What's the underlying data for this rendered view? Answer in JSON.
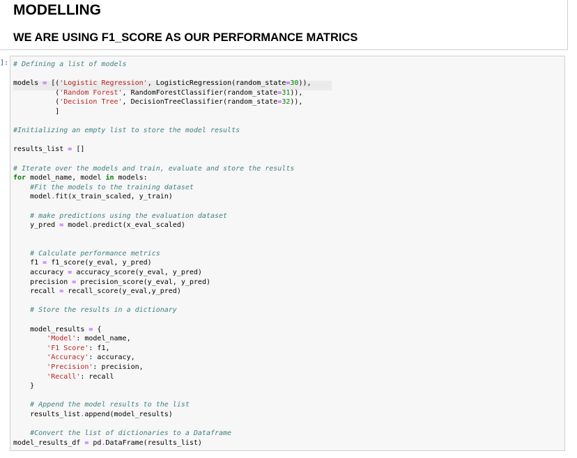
{
  "markdown": {
    "title": "MODELLING",
    "subtitle": "WE ARE USING F1_SCORE AS OUR PERFORMANCE MATRICS"
  },
  "code_cell": {
    "prompt": "]:",
    "lines": [
      [
        [
          "c",
          "# Defining a list of models"
        ]
      ],
      [],
      [
        [
          "",
          "models "
        ],
        [
          "o",
          "="
        ],
        [
          "",
          " [("
        ],
        [
          "s",
          "'Logistic Regression'"
        ],
        [
          "",
          ", LogisticRegression(random_state"
        ],
        [
          "o",
          "="
        ],
        [
          "n",
          "30"
        ],
        [
          "",
          ")),"
        ]
      ],
      [
        [
          "",
          "          ("
        ],
        [
          "s",
          "'Random Forest'"
        ],
        [
          "",
          ", RandomForestClassifier(random_state"
        ],
        [
          "o",
          "="
        ],
        [
          "n",
          "31"
        ],
        [
          "",
          ")),"
        ]
      ],
      [
        [
          "",
          "          ("
        ],
        [
          "s",
          "'Decision Tree'"
        ],
        [
          "",
          ", DecisionTreeClassifier(random_state"
        ],
        [
          "o",
          "="
        ],
        [
          "n",
          "32"
        ],
        [
          "",
          ")),"
        ]
      ],
      [
        [
          "",
          "          ]"
        ]
      ],
      [],
      [
        [
          "c",
          "#Initializing an empty list to store the model results"
        ]
      ],
      [],
      [
        [
          "",
          "results_list "
        ],
        [
          "o",
          "="
        ],
        [
          "",
          " []"
        ]
      ],
      [],
      [
        [
          "c",
          "# Iterate over the models and train, evaluate and store the results"
        ]
      ],
      [
        [
          "k",
          "for"
        ],
        [
          "",
          " model_name, model "
        ],
        [
          "k",
          "in"
        ],
        [
          "",
          " models:"
        ]
      ],
      [
        [
          "",
          "    "
        ],
        [
          "c",
          "#Fit the models to the training dataset"
        ]
      ],
      [
        [
          "",
          "    model"
        ],
        [
          "o",
          "."
        ],
        [
          "",
          "fit(x_train_scaled, y_train)"
        ]
      ],
      [],
      [
        [
          "",
          "    "
        ],
        [
          "c",
          "# make predictions using the evaluation dataset"
        ]
      ],
      [
        [
          "",
          "    y_pred "
        ],
        [
          "o",
          "="
        ],
        [
          "",
          " model"
        ],
        [
          "o",
          "."
        ],
        [
          "",
          "predict(x_eval_scaled)"
        ]
      ],
      [],
      [],
      [
        [
          "",
          "    "
        ],
        [
          "c",
          "# Calculate performance metrics"
        ]
      ],
      [
        [
          "",
          "    f1 "
        ],
        [
          "o",
          "="
        ],
        [
          "",
          " f1_score(y_eval, y_pred)"
        ]
      ],
      [
        [
          "",
          "    accuracy "
        ],
        [
          "o",
          "="
        ],
        [
          "",
          " accuracy_score(y_eval, y_pred)"
        ]
      ],
      [
        [
          "",
          "    precision "
        ],
        [
          "o",
          "="
        ],
        [
          "",
          " precision_score(y_eval, y_pred)"
        ]
      ],
      [
        [
          "",
          "    recall "
        ],
        [
          "o",
          "="
        ],
        [
          "",
          " recall_score(y_eval,y_pred)"
        ]
      ],
      [],
      [
        [
          "",
          "    "
        ],
        [
          "c",
          "# Store the results in a dictionary"
        ]
      ],
      [],
      [
        [
          "",
          "    model_results "
        ],
        [
          "o",
          "="
        ],
        [
          "",
          " {"
        ]
      ],
      [
        [
          "",
          "        "
        ],
        [
          "s",
          "'Model'"
        ],
        [
          "",
          ": model_name,"
        ]
      ],
      [
        [
          "",
          "        "
        ],
        [
          "s",
          "'F1 Score'"
        ],
        [
          "",
          ": f1,"
        ]
      ],
      [
        [
          "",
          "        "
        ],
        [
          "s",
          "'Accuracy'"
        ],
        [
          "",
          ": accuracy,"
        ]
      ],
      [
        [
          "",
          "        "
        ],
        [
          "s",
          "'Precision'"
        ],
        [
          "",
          ": precision,"
        ]
      ],
      [
        [
          "",
          "        "
        ],
        [
          "s",
          "'Recall'"
        ],
        [
          "",
          ": recall"
        ]
      ],
      [
        [
          "",
          "    }"
        ]
      ],
      [],
      [
        [
          "",
          "    "
        ],
        [
          "c",
          "# Append the model results to the list"
        ]
      ],
      [
        [
          "",
          "    results_list"
        ],
        [
          "o",
          "."
        ],
        [
          "",
          "append(model_results)"
        ]
      ],
      [],
      [
        [
          "",
          "    "
        ],
        [
          "c",
          "#Convert the list of dictionaries to a Dataframe"
        ]
      ],
      [
        [
          "",
          "model_results_df "
        ],
        [
          "o",
          "="
        ],
        [
          "",
          " pd"
        ],
        [
          "o",
          "."
        ],
        [
          "",
          "DataFrame(results_list)"
        ]
      ]
    ]
  }
}
